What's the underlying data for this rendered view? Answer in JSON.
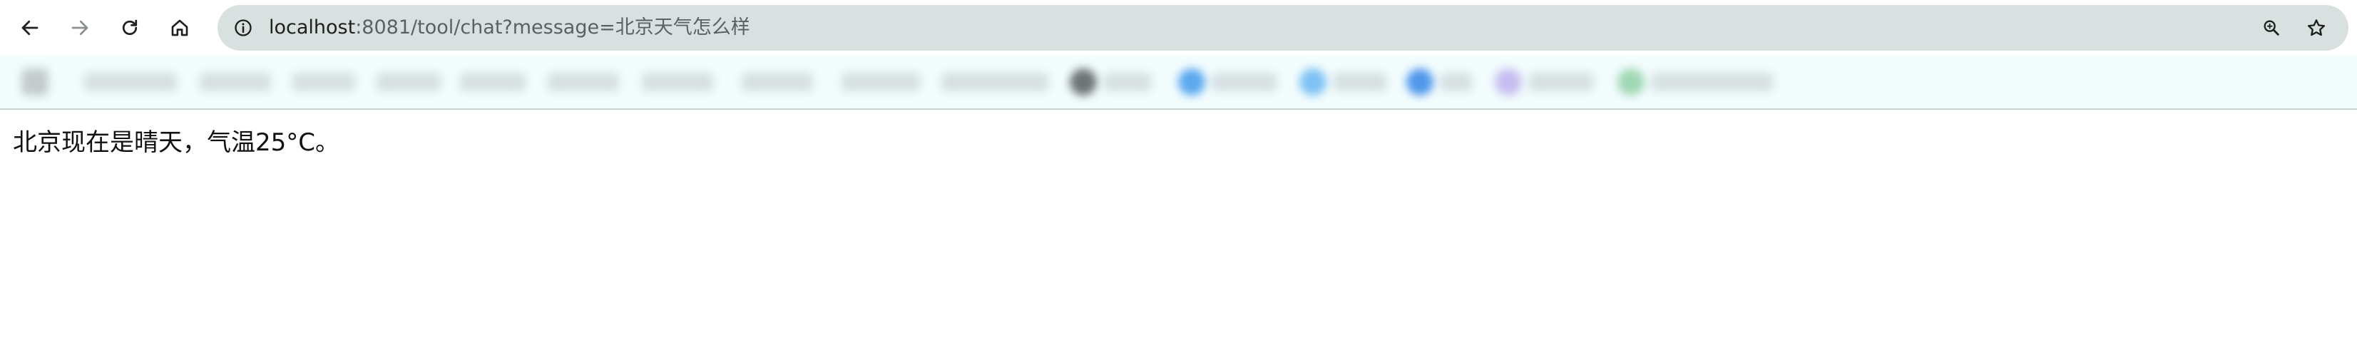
{
  "browser": {
    "address_bar": {
      "host": "localhost",
      "rest": ":8081/tool/chat?message=北京天气怎么样"
    },
    "icons": {
      "back": "arrow-left-icon",
      "forward": "arrow-right-icon",
      "reload": "reload-icon",
      "home": "home-icon",
      "site_info": "info-circle-icon",
      "zoom": "zoom-icon",
      "bookmark": "star-icon"
    },
    "colors": {
      "omnibox_bg": "#d9e0e0",
      "bookmarks_bar_bg": "#f2fcfd"
    }
  },
  "page": {
    "response_text": "北京现在是晴天，气温25°C。"
  }
}
